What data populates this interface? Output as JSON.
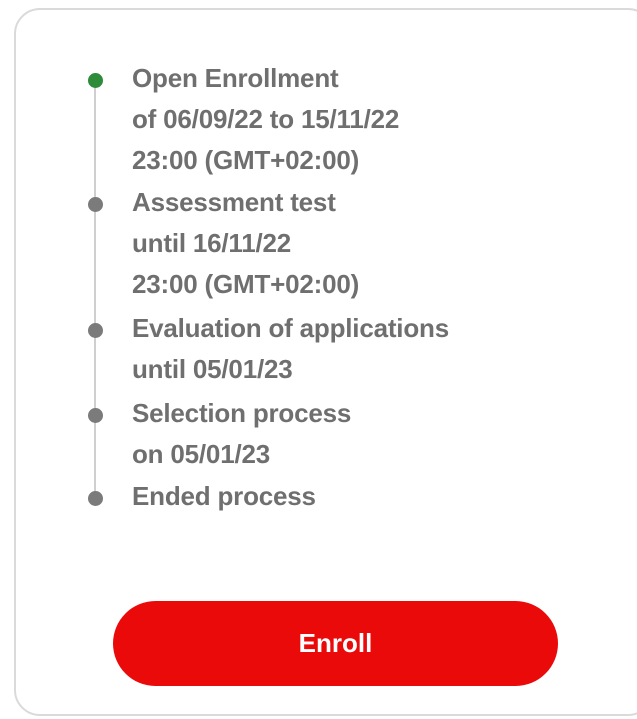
{
  "steps": [
    {
      "title": "Open Enrollment",
      "line2": "of 06/09/22 to 15/11/22",
      "line3": "23:00 (GMT+02:00)",
      "status": "active",
      "dot_color": "#2e8b3a"
    },
    {
      "title": "Assessment test",
      "line2": "until 16/11/22",
      "line3": "23:00 (GMT+02:00)",
      "status": "pending",
      "dot_color": "#7b7b7b"
    },
    {
      "title": "Evaluation of applications",
      "line2": "until 05/01/23",
      "status": "pending",
      "dot_color": "#7b7b7b"
    },
    {
      "title": "Selection process",
      "line2": "on 05/01/23",
      "status": "pending",
      "dot_color": "#7b7b7b"
    },
    {
      "title": "Ended process",
      "status": "pending",
      "dot_color": "#7b7b7b"
    }
  ],
  "enroll_button": {
    "label": "Enroll",
    "color": "#ea0a0a"
  }
}
